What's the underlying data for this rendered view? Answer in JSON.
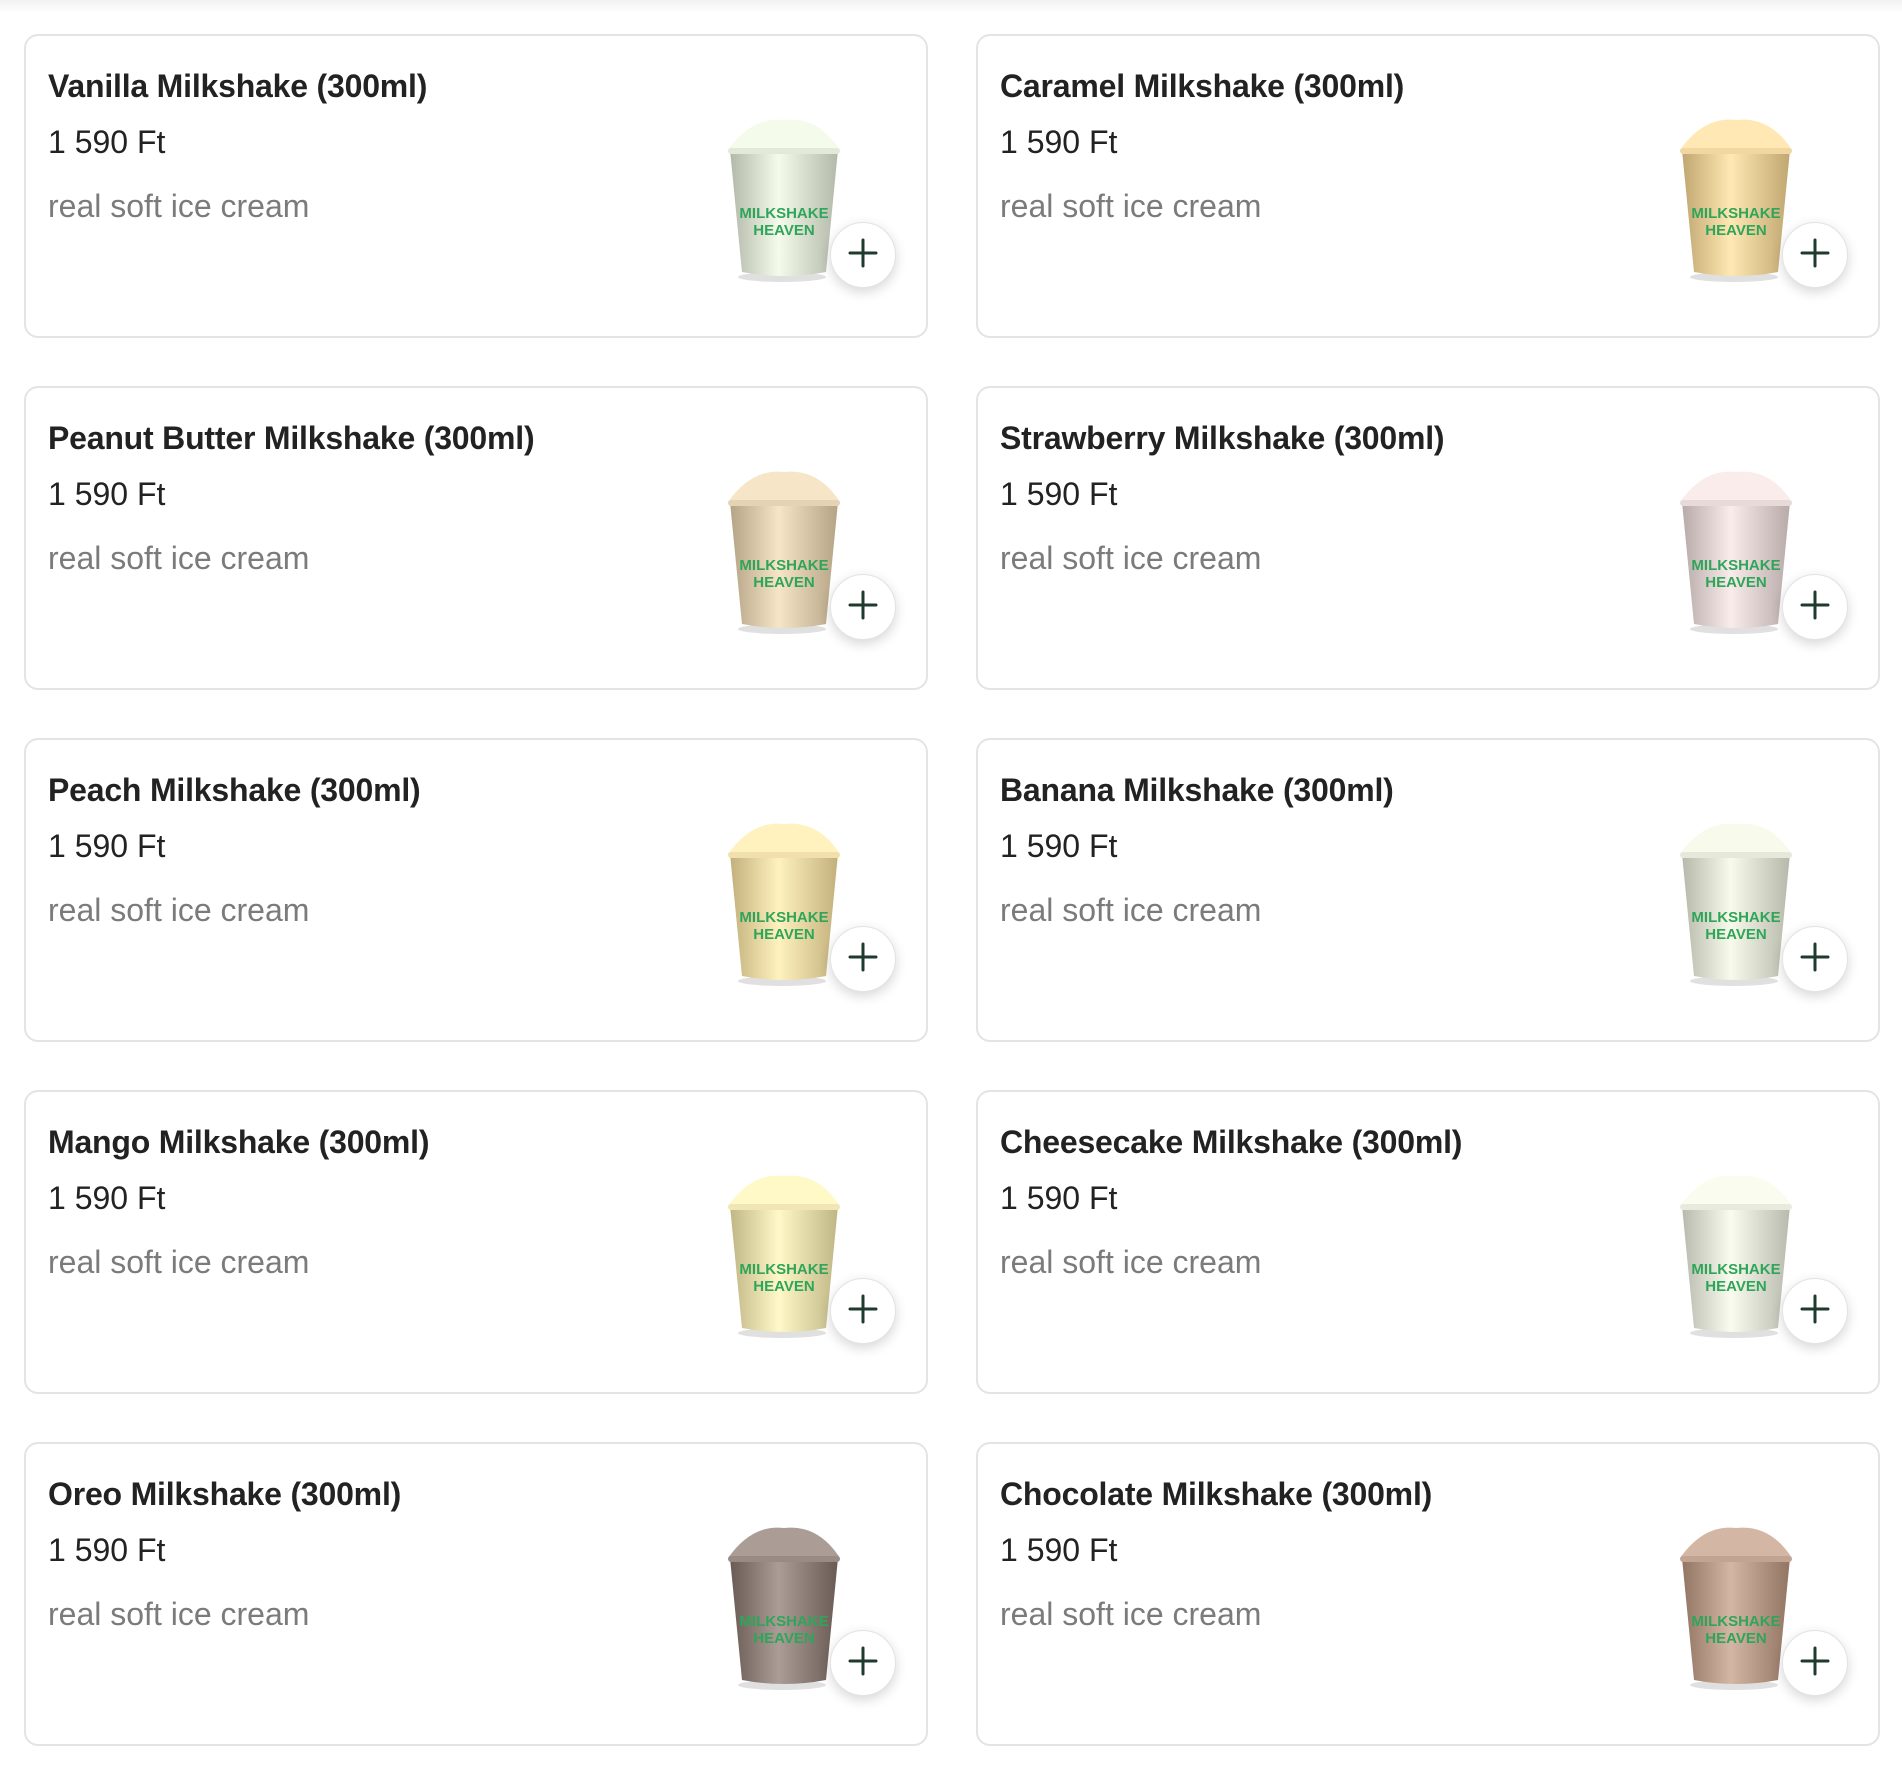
{
  "products": [
    {
      "name": "Vanilla Milkshake (300ml)",
      "price": "1 590 Ft",
      "description": "real soft ice cream",
      "shake_color": "#d9dfcf",
      "cup_text": "MILKSHAKE HEAVEN",
      "image": "vanilla-milkshake-cup"
    },
    {
      "name": "Caramel Milkshake (300ml)",
      "price": "1 590 Ft",
      "description": "real soft ice cream",
      "shake_color": "#e6cc97",
      "cup_text": "MILKSHAKE HEAVEN",
      "image": "caramel-milkshake-cup"
    },
    {
      "name": "Peanut Butter Milkshake (300ml)",
      "price": "1 590 Ft",
      "description": "real soft ice cream",
      "shake_color": "#dac9aa",
      "cup_text": "MILKSHAKE HEAVEN",
      "image": "peanut-butter-milkshake-cup"
    },
    {
      "name": "Strawberry Milkshake (300ml)",
      "price": "1 590 Ft",
      "description": "real soft ice cream",
      "shake_color": "#ddd0cf",
      "cup_text": "MILKSHAKE HEAVEN",
      "image": "strawberry-milkshake-cup"
    },
    {
      "name": "Peach Milkshake (300ml)",
      "price": "1 590 Ft",
      "description": "real soft ice cream",
      "shake_color": "#e8d6a2",
      "cup_text": "MILKSHAKE HEAVEN",
      "image": "peach-milkshake-cup"
    },
    {
      "name": "Banana Milkshake (300ml)",
      "price": "1 590 Ft",
      "description": "real soft ice cream",
      "shake_color": "#dcdfcf",
      "cup_text": "MILKSHAKE HEAVEN",
      "image": "banana-milkshake-cup"
    },
    {
      "name": "Mango Milkshake (300ml)",
      "price": "1 590 Ft",
      "description": "real soft ice cream",
      "shake_color": "#e6dcab",
      "cup_text": "MILKSHAKE HEAVEN",
      "image": "mango-milkshake-cup"
    },
    {
      "name": "Cheesecake Milkshake (300ml)",
      "price": "1 590 Ft",
      "description": "real soft ice cream",
      "shake_color": "#dde0d2",
      "cup_text": "MILKSHAKE HEAVEN",
      "image": "cheesecake-milkshake-cup"
    },
    {
      "name": "Oreo Milkshake (300ml)",
      "price": "1 590 Ft",
      "description": "real soft ice cream",
      "shake_color": "#8f817a",
      "cup_text": "MILKSHAKE HEAVEN",
      "image": "oreo-milkshake-cup"
    },
    {
      "name": "Chocolate Milkshake (300ml)",
      "price": "1 590 Ft",
      "description": "real soft ice cream",
      "shake_color": "#b89a88",
      "cup_text": "MILKSHAKE HEAVEN",
      "image": "chocolate-milkshake-cup"
    }
  ],
  "add_button": {
    "icon": "plus-icon",
    "color": "#1f3a2e"
  },
  "brand_text_color": "#2fa55a"
}
